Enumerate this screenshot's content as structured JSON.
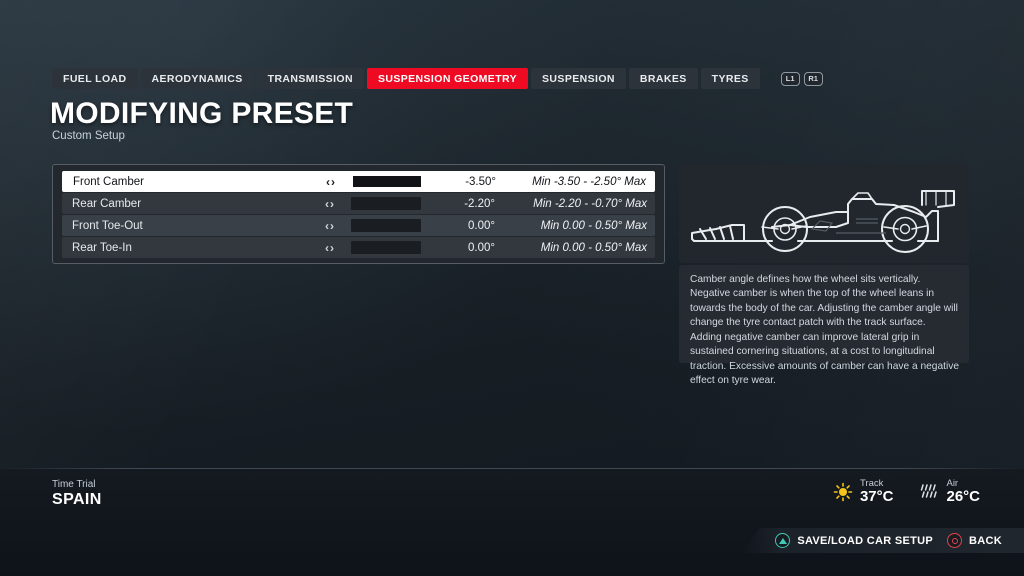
{
  "tabs": [
    {
      "label": "FUEL LOAD",
      "active": false
    },
    {
      "label": "AERODYNAMICS",
      "active": false
    },
    {
      "label": "TRANSMISSION",
      "active": false
    },
    {
      "label": "SUSPENSION GEOMETRY",
      "active": true
    },
    {
      "label": "SUSPENSION",
      "active": false
    },
    {
      "label": "BRAKES",
      "active": false
    },
    {
      "label": "TYRES",
      "active": false
    }
  ],
  "bumpers": [
    {
      "label": "L1"
    },
    {
      "label": "R1"
    }
  ],
  "header": {
    "title": "MODIFYING PRESET",
    "subtitle": "Custom Setup"
  },
  "setup": {
    "arrow_left": "‹",
    "arrow_right": "›",
    "rows": [
      {
        "label": "Front Camber",
        "value": "-3.50°",
        "range": "Min -3.50 - -2.50° Max",
        "fill_percent": 0,
        "selected": true
      },
      {
        "label": "Rear Camber",
        "value": "-2.20°",
        "range": "Min -2.20 - -0.70° Max",
        "fill_percent": 0,
        "selected": false
      },
      {
        "label": "Front Toe-Out",
        "value": "0.00°",
        "range": "Min 0.00 - 0.50° Max",
        "fill_percent": 0,
        "selected": false
      },
      {
        "label": "Rear Toe-In",
        "value": "0.00°",
        "range": "Min 0.00 - 0.50° Max",
        "fill_percent": 0,
        "selected": false
      }
    ]
  },
  "car_preview": {
    "icon": "f1-car-side-profile-icon"
  },
  "description": {
    "text": "Camber angle defines how the wheel sits vertically. Negative camber is when the top of the wheel leans in towards the body of the car. Adjusting the camber angle will change the tyre contact patch with the track surface. Adding negative camber can improve lateral grip in sustained cornering situations, at a cost to longitudinal traction. Excessive amounts of camber can have a negative effect on tyre wear."
  },
  "footer": {
    "session": {
      "type": "Time Trial",
      "name": "SPAIN"
    },
    "weather": [
      {
        "label": "Track",
        "value": "37°C",
        "icon": "sun-icon"
      },
      {
        "label": "Air",
        "value": "26°C",
        "icon": "rain-icon"
      }
    ],
    "prompts": [
      {
        "label": "SAVE/LOAD CAR SETUP",
        "button": "triangle"
      },
      {
        "label": "BACK",
        "button": "circle"
      }
    ]
  },
  "colors": {
    "accent_red": "#ee0a22",
    "triangle_teal": "#41c9b4",
    "circle_red": "#e8414c",
    "sun_yellow": "#f5c518"
  }
}
